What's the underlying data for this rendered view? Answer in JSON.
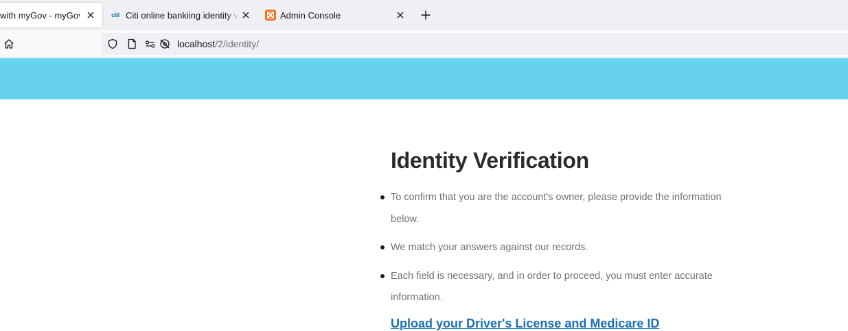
{
  "browser": {
    "tabs": [
      {
        "title": "with myGov - myGov",
        "active": true
      },
      {
        "title": "Citi online bankiing identity veri",
        "favicon": "citi",
        "active": false
      },
      {
        "title": "Admin Console",
        "favicon": "xampp-icon",
        "active": false
      }
    ],
    "url": {
      "host": "localhost",
      "path": "/2/identity/"
    }
  },
  "colors": {
    "banner": "#67d2ed",
    "link": "#1a6fb5",
    "heading": "#2b2b2b",
    "body_text": "#707070"
  },
  "page": {
    "heading": "Identity Verification",
    "bullets": [
      "To confirm that you are the account's owner, please provide the information below.",
      "We match your answers against our records.",
      "Each field is necessary, and in order to proceed, you must enter accurate information."
    ],
    "upload_link": "Upload your Driver's License and Medicare ID"
  }
}
